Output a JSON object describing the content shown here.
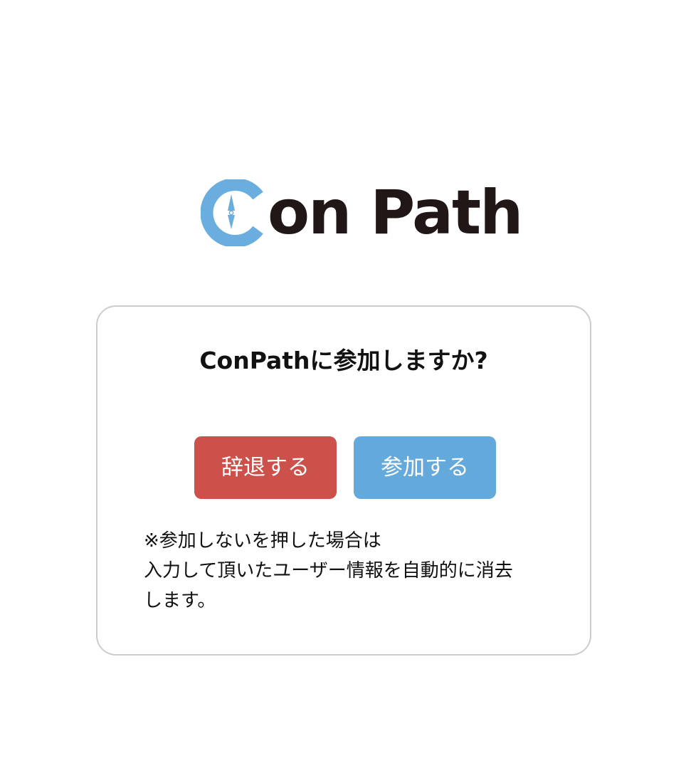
{
  "logo": {
    "text": "on Path",
    "accent_color": "#6aaedf",
    "text_color": "#211716"
  },
  "dialog": {
    "question": "ConPathに参加しますか?",
    "decline_label": "辞退する",
    "join_label": "参加する",
    "decline_color": "#cd514b",
    "join_color": "#64a9dc",
    "note_lines": [
      "※参加しないを押した場合は",
      "入力して頂いたユーザー情報を自動的に消去",
      "します。"
    ]
  }
}
